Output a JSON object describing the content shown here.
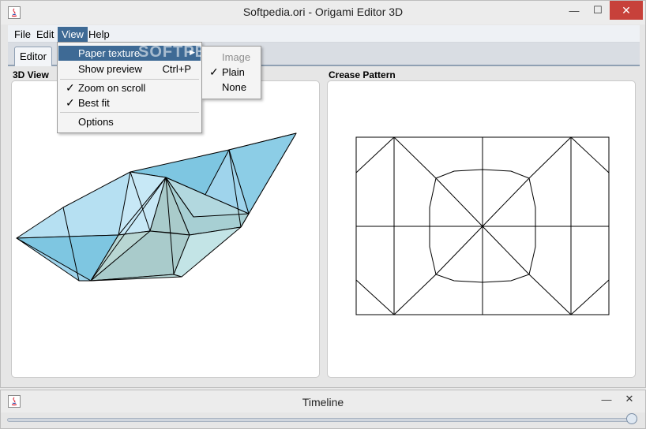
{
  "main_window": {
    "title": "Softpedia.ori - Origami Editor 3D",
    "controls": {
      "minimize": "—",
      "maximize": "☐",
      "close": "✕"
    }
  },
  "menubar": {
    "items": [
      "File",
      "Edit",
      "View",
      "Help"
    ],
    "active": "View"
  },
  "tabs": [
    "Editor"
  ],
  "panes": {
    "left_title": "3D View",
    "right_title": "Crease Pattern"
  },
  "view_menu": {
    "items": [
      {
        "label": "Paper texture",
        "has_submenu": true,
        "highlighted": true
      },
      {
        "label": "Show preview",
        "accelerator": "Ctrl+P"
      },
      {
        "label": "Zoom on scroll",
        "checked": true
      },
      {
        "label": "Best fit",
        "checked": true
      },
      {
        "label": "Options"
      }
    ]
  },
  "texture_submenu": {
    "items": [
      {
        "label": "Image",
        "enabled": false
      },
      {
        "label": "Plain",
        "checked": true
      },
      {
        "label": "None"
      }
    ]
  },
  "check_glyph": "✓",
  "submenu_arrow": "▶",
  "watermark": "SOFTPEDIA",
  "timeline_window": {
    "title": "Timeline",
    "controls": {
      "minimize": "—",
      "close": "✕"
    },
    "slider_value": 1.0
  },
  "colors": {
    "menu_highlight": "#3e6a95",
    "paper_light": "#c7e8f6",
    "paper_mid": "#9fd4ec",
    "paper_dark": "#7ec6e1",
    "paper_grey": "#a9cbcb",
    "close_button": "#c7413a"
  }
}
